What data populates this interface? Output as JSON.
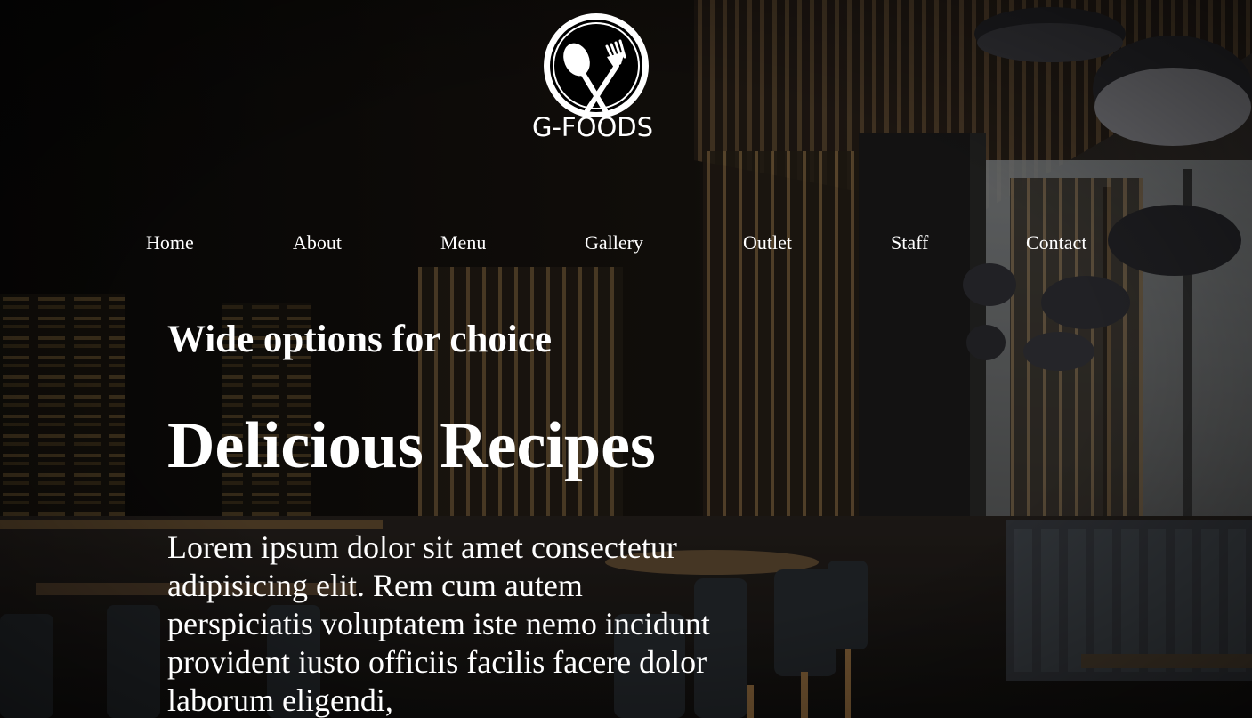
{
  "brand": {
    "logo_text": "G-FOODS",
    "logo_icon": "spoon-fork-icon"
  },
  "nav": {
    "items": [
      "Home",
      "About",
      "Menu",
      "Gallery",
      "Outlet",
      "Staff",
      "Contact"
    ]
  },
  "hero": {
    "subtitle": "Wide options for choice",
    "title": "Delicious Recipes",
    "description": "Lorem ipsum dolor sit amet consectetur adipisicing elit. Rem cum autem perspiciatis voluptatem iste nemo incidunt provident iusto officiis facilis facere dolor laborum eligendi,",
    "background": "restaurant-interior-photo"
  },
  "colors": {
    "text": "#ffffff",
    "overlay": "#000000"
  }
}
